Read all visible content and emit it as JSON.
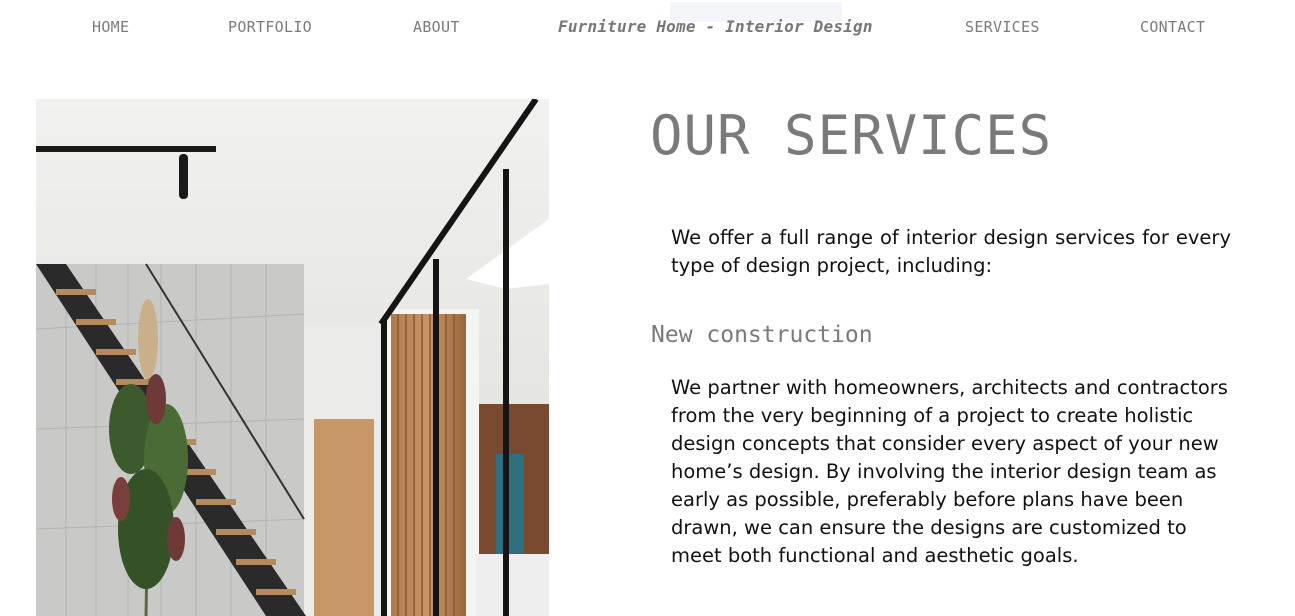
{
  "nav": {
    "items": [
      {
        "label": "HOME"
      },
      {
        "label": "PORTFOLIO"
      },
      {
        "label": "ABOUT"
      },
      {
        "label": "SERVICES"
      },
      {
        "label": "CONTACT"
      }
    ],
    "brand": "Furniture Home - Interior Design"
  },
  "main": {
    "title": "OUR SERVICES",
    "intro": "We offer a full range of interior design services for every type of design project, including:",
    "section_heading": "New construction",
    "section_body": "We partner with homeowners, architects and contractors from the very beginning of a project to create holistic design concepts that consider every aspect of your new home’s design. By involving the interior design team as early as possible, preferably before plans have been drawn, we can ensure the designs are customized to meet both functional and aesthetic goals."
  },
  "colors": {
    "nav_text": "#7b7b7b",
    "heading": "#7a7a7a",
    "body_text": "#111111",
    "background": "#ffffff"
  }
}
